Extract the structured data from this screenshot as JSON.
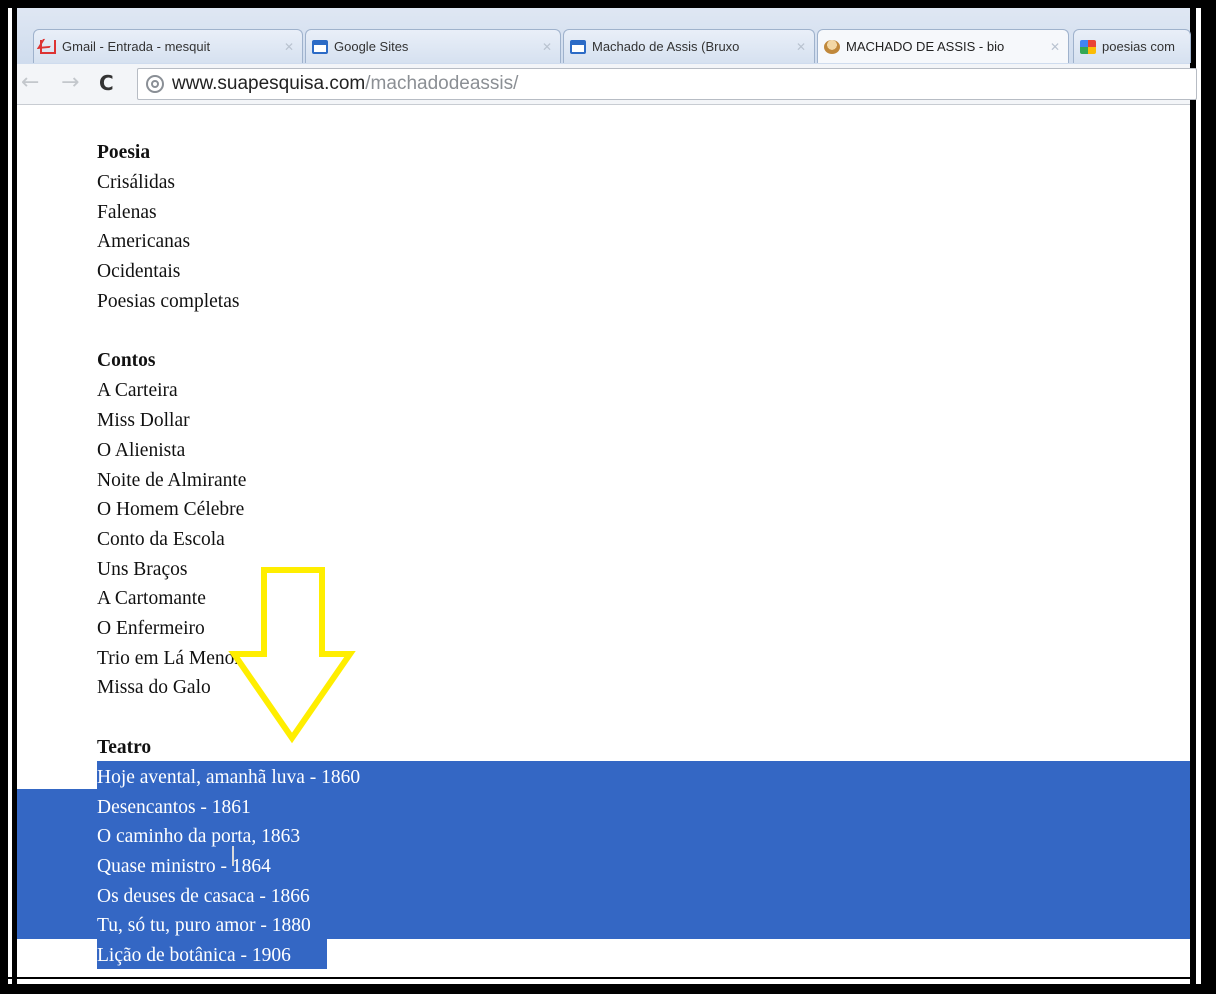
{
  "browser": {
    "tabs": [
      {
        "label": "Gmail - Entrada - mesquit",
        "favicon": "gmail-icon",
        "active": false
      },
      {
        "label": "Google Sites",
        "favicon": "page-icon",
        "active": false
      },
      {
        "label": "Machado de Assis (Bruxo",
        "favicon": "page-icon",
        "active": false
      },
      {
        "label": "MACHADO DE ASSIS - bio",
        "favicon": "avatar-icon",
        "active": true
      },
      {
        "label": "poesias com",
        "favicon": "google-icon",
        "active": false
      }
    ],
    "url": {
      "host": "www.suapesquisa.com",
      "path": "/machadodeassis/"
    }
  },
  "sections": {
    "poesia": {
      "heading": "Poesia",
      "items": [
        "Crisálidas",
        "Falenas",
        "Americanas",
        "Ocidentais",
        "Poesias completas"
      ]
    },
    "contos": {
      "heading": "Contos",
      "items": [
        "A Carteira",
        "Miss Dollar",
        "O Alienista",
        "Noite de Almirante",
        "O Homem Célebre",
        "Conto da Escola",
        "Uns Braços",
        "A Cartomante",
        "O Enfermeiro",
        "Trio em Lá Menor",
        "Missa do Galo"
      ]
    },
    "teatro": {
      "heading": "Teatro",
      "items": [
        "Hoje avental, amanhã luva - 1860",
        "Desencantos - 1861",
        "O caminho da porta, 1863",
        "Quase ministro - 1864",
        "Os deuses de casaca - 1866",
        "Tu, só tu, puro amor - 1880",
        "Lição de botânica - 1906"
      ]
    }
  },
  "colors": {
    "selection": "#3467c4",
    "annotation_arrow": "#ffee00"
  }
}
